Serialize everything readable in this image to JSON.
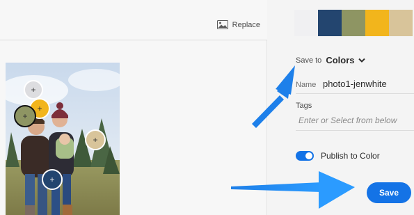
{
  "toolbar": {
    "replace_label": "Replace"
  },
  "palette": {
    "colors": [
      "#f0f0f2",
      "#23456f",
      "#8e9563",
      "#f2b51c",
      "#d8c49a"
    ]
  },
  "save_to": {
    "label": "Save to",
    "destination": "Colors"
  },
  "name_field": {
    "label": "Name",
    "value": "photo1-jenwhite"
  },
  "tags": {
    "label": "Tags",
    "placeholder": "Enter or Select from below"
  },
  "publish": {
    "label": "Publish to Color",
    "enabled": true
  },
  "save_button": {
    "label": "Save"
  },
  "swatch_markers": [
    {
      "color": "#dddde0",
      "symbol": "+"
    },
    {
      "color": "#f2b51c",
      "symbol": "+"
    },
    {
      "color": "#8e9563",
      "symbol": "+"
    },
    {
      "color": "#d8c49a",
      "symbol": "+"
    },
    {
      "color": "#23456f",
      "symbol": "+"
    }
  ]
}
